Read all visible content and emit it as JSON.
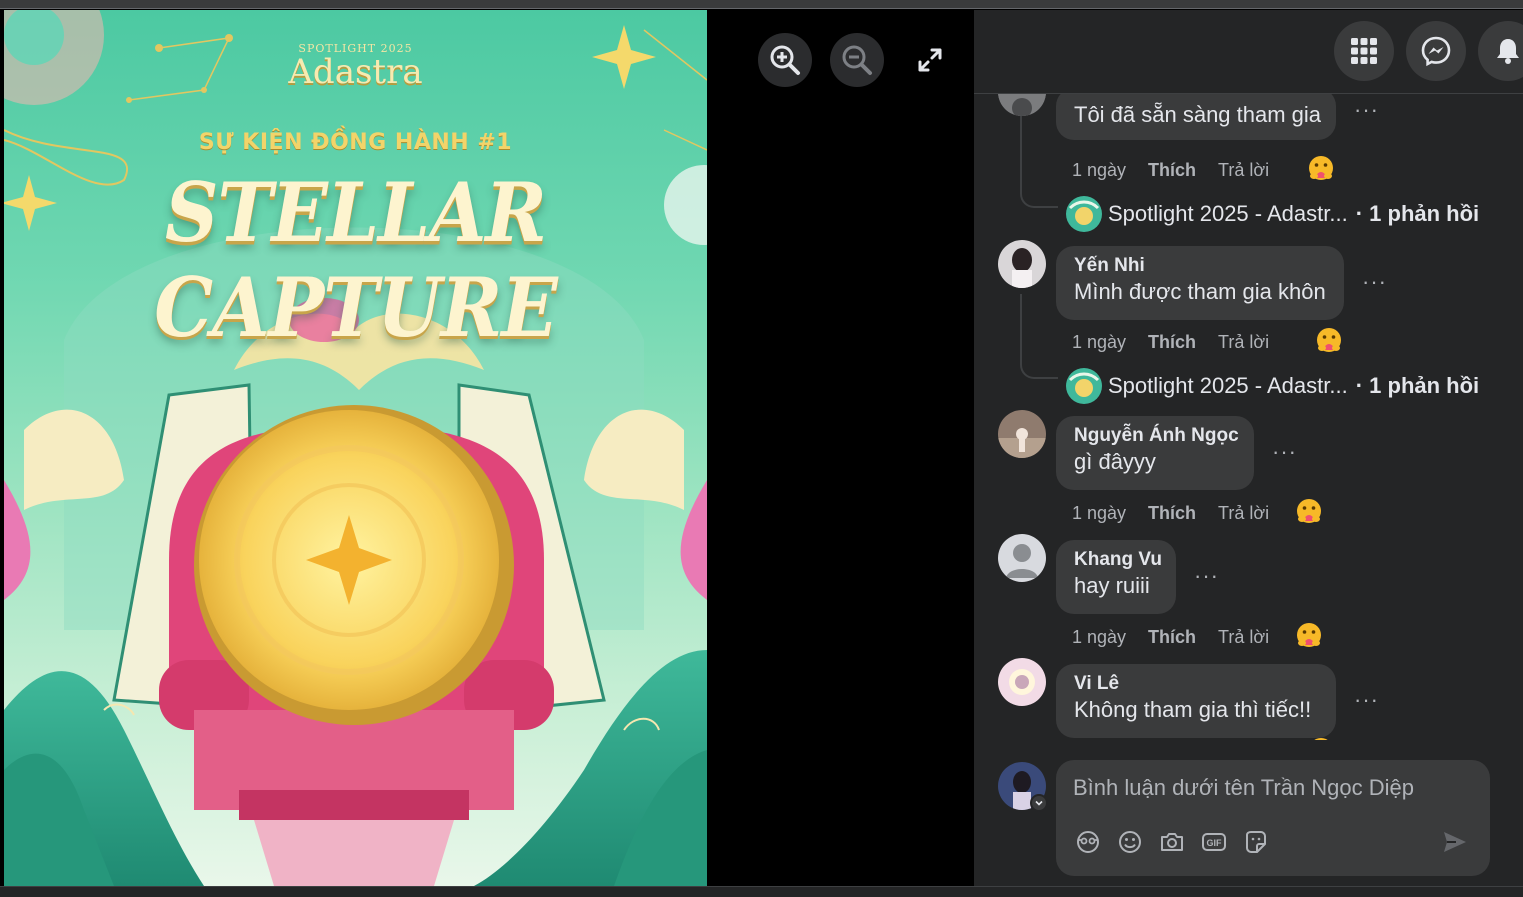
{
  "poster": {
    "spotlight": "SPOTLIGHT 2025",
    "brand": "Adastra",
    "event": "SỰ KIỆN ĐỒNG HÀNH #1",
    "title": "STELLAR CAPTURE"
  },
  "comments": [
    {
      "text": "Tôi đã sẵn sàng tham gia",
      "time": "1 ngày",
      "like": "Thích",
      "reply": "Trả lời",
      "reply_thread": {
        "name": "Spotlight 2025 - Adastr...",
        "count": "· 1 phản hồi"
      }
    },
    {
      "name": "Yến Nhi",
      "text": "Mình được tham gia khôn",
      "time": "1 ngày",
      "like": "Thích",
      "reply": "Trả lời",
      "reply_thread": {
        "name": "Spotlight 2025 - Adastr...",
        "count": "· 1 phản hồi"
      }
    },
    {
      "name": "Nguyễn Ánh Ngọc",
      "text": "gì đâyyy",
      "time": "1 ngày",
      "like": "Thích",
      "reply": "Trả lời"
    },
    {
      "name": "Khang Vu",
      "text": "hay ruiii",
      "time": "1 ngày",
      "like": "Thích",
      "reply": "Trả lời"
    },
    {
      "name": "Vi Lê",
      "text": "Không tham gia thì tiếc!!"
    }
  ],
  "more_label": "···",
  "composer": {
    "placeholder": "Bình luận dưới tên Trần Ngọc Diệp",
    "gif_label": "GIF"
  },
  "colors": {
    "panel_bg": "#242526",
    "bubble_bg": "#3a3b3c",
    "text_primary": "#e4e6eb",
    "text_secondary": "#b0b3b8"
  }
}
